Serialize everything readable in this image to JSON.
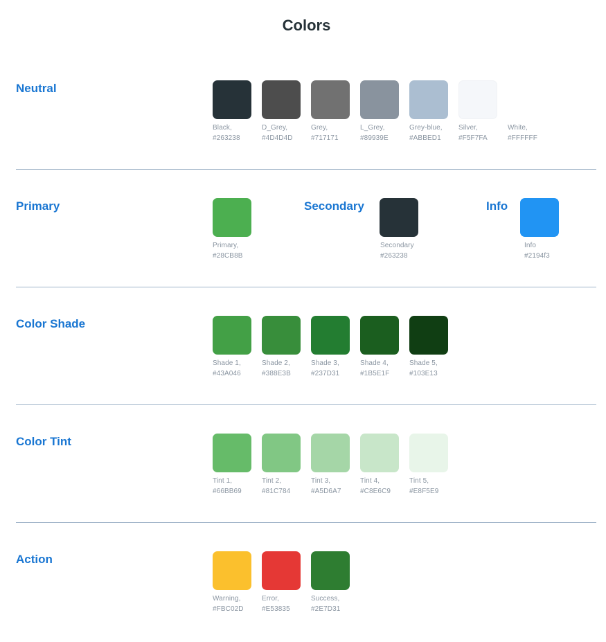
{
  "title": "Colors",
  "sections": [
    {
      "title": "Neutral",
      "swatches": [
        {
          "name": "Black,",
          "hex": "#263238",
          "color": "#263238"
        },
        {
          "name": "D_Grey,",
          "hex": "#4D4D4D",
          "color": "#4D4D4D"
        },
        {
          "name": "Grey,",
          "hex": "#717171",
          "color": "#717171"
        },
        {
          "name": "L_Grey,",
          "hex": "#89939E",
          "color": "#89939E"
        },
        {
          "name": "Grey-blue,",
          "hex": "#ABBED1",
          "color": "#ABBED1"
        },
        {
          "name": "Silver,",
          "hex": "#F5F7FA",
          "color": "#F5F7FA"
        },
        {
          "name": "White,",
          "hex": "#FFFFFF",
          "color": "#FFFFFF"
        }
      ]
    },
    {
      "title": "Primary",
      "secondary_title": "Secondary",
      "info_title": "Info",
      "swatches": [
        {
          "name": "Primary,",
          "hex": "#28CB8B",
          "color": "#4CAF50"
        },
        {
          "name": "Secondary",
          "hex": "#263238",
          "color": "#263238"
        },
        {
          "name": "Info",
          "hex": "#2194f3",
          "color": "#2194F3"
        }
      ]
    },
    {
      "title": "Color Shade",
      "swatches": [
        {
          "name": "Shade 1,",
          "hex": "#43A046",
          "color": "#43A046"
        },
        {
          "name": "Shade 2,",
          "hex": "#388E3B",
          "color": "#388E3B"
        },
        {
          "name": "Shade 3,",
          "hex": "#237D31",
          "color": "#237D31"
        },
        {
          "name": "Shade 4,",
          "hex": "#1B5E1F",
          "color": "#1B5E1F"
        },
        {
          "name": "Shade 5,",
          "hex": "#103E13",
          "color": "#103E13"
        }
      ]
    },
    {
      "title": "Color Tint",
      "swatches": [
        {
          "name": "Tint 1,",
          "hex": "#66BB69",
          "color": "#66BB69"
        },
        {
          "name": "Tint 2,",
          "hex": "#81C784",
          "color": "#81C784"
        },
        {
          "name": "Tint 3,",
          "hex": "#A5D6A7",
          "color": "#A5D6A7"
        },
        {
          "name": "Tint 4,",
          "hex": "#C8E6C9",
          "color": "#C8E6C9"
        },
        {
          "name": "Tint 5,",
          "hex": "#E8F5E9",
          "color": "#E8F5E9"
        }
      ]
    },
    {
      "title": "Action",
      "swatches": [
        {
          "name": "Warning,",
          "hex": "#FBC02D",
          "color": "#FBC02D"
        },
        {
          "name": "Error,",
          "hex": "#E53835",
          "color": "#E53835"
        },
        {
          "name": "Success,",
          "hex": "#2E7D31",
          "color": "#2E7D31"
        }
      ]
    }
  ]
}
